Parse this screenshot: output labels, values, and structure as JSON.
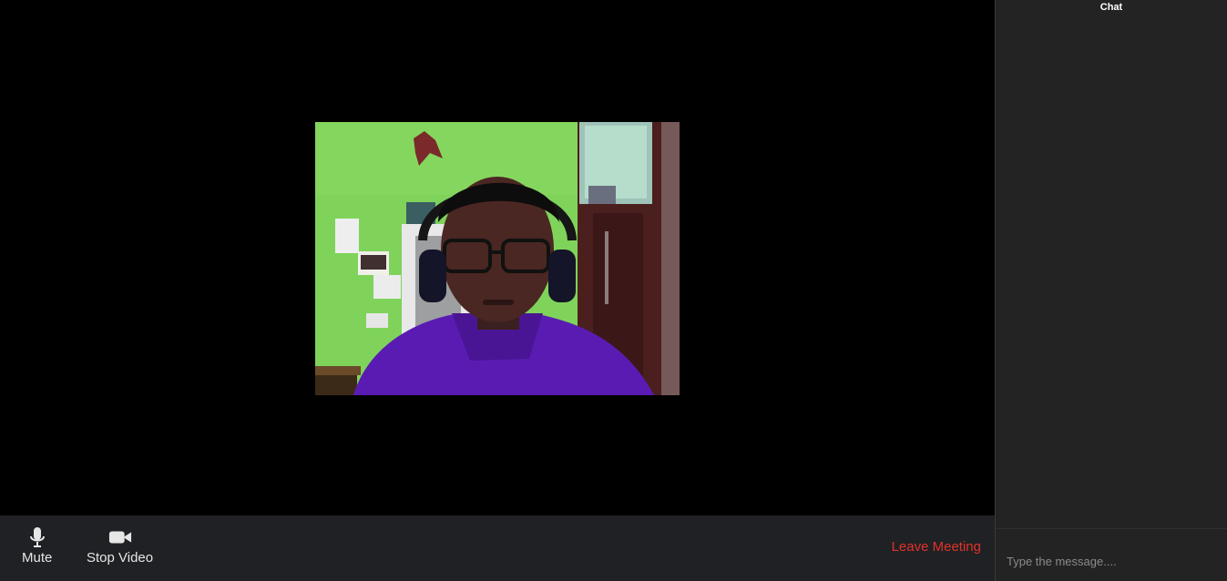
{
  "chat": {
    "title": "Chat",
    "input_placeholder": "Type the message...."
  },
  "controls": {
    "mute_label": "Mute",
    "mute_icon": "microphone-icon",
    "video_label": "Stop Video",
    "video_icon": "video-camera-icon",
    "leave_label": "Leave Meeting",
    "leave_color": "#e0322b"
  },
  "theme": {
    "stage_bg": "#000000",
    "controls_bg": "#202124",
    "chat_bg": "#232323"
  }
}
